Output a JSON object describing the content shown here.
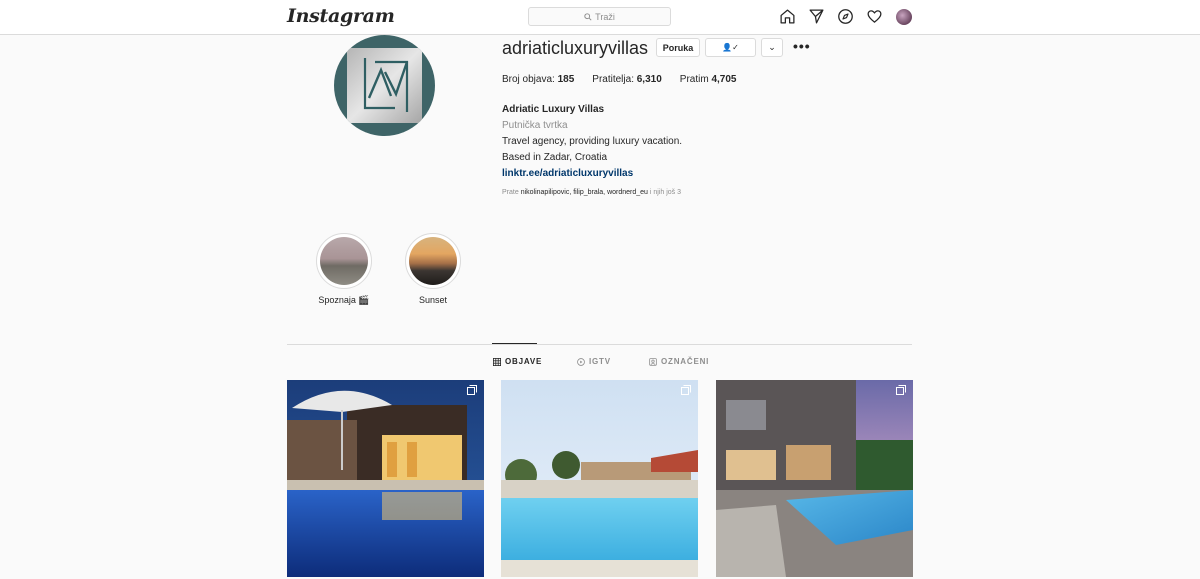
{
  "nav": {
    "logo": "Instagram",
    "search_placeholder": "Traži",
    "icons": [
      "home-icon",
      "direct-icon",
      "explore-icon",
      "activity-heart-icon",
      "profile-avatar"
    ]
  },
  "profile": {
    "username": "adriaticluxuryvillas",
    "message_button": "Poruka",
    "following_button": "👤✓",
    "dropdown_button": "⌄",
    "more": "•••",
    "stats": {
      "posts_label": "Broj objava:",
      "posts_value": "185",
      "followers_label": "Pratitelja:",
      "followers_value": "6,310",
      "following_label": "Pratim",
      "following_value": "4,705"
    },
    "bio": {
      "name": "Adriatic Luxury Villas",
      "category": "Putnička tvrtka",
      "line1": "Travel agency, providing luxury vacation.",
      "line2": "Based in Zadar, Croatia",
      "link": "linktr.ee/adriaticluxuryvillas"
    },
    "followed_by": {
      "prefix": "Prate",
      "users": "nikolinapilipovic, filip_brala, wordnerd_eu",
      "suffix": "i njih još 3"
    }
  },
  "highlights": [
    {
      "label": "Spoznaja 🎬"
    },
    {
      "label": "Sunset"
    }
  ],
  "tabs": [
    {
      "label": "OBJAVE",
      "active": true
    },
    {
      "label": "IGTV",
      "active": false
    },
    {
      "label": "OZNAČENI",
      "active": false
    }
  ],
  "colors": {
    "link": "#00376b",
    "border": "#dbdbdb",
    "muted": "#8e8e8e",
    "avatar_bg": "#3e6467"
  }
}
